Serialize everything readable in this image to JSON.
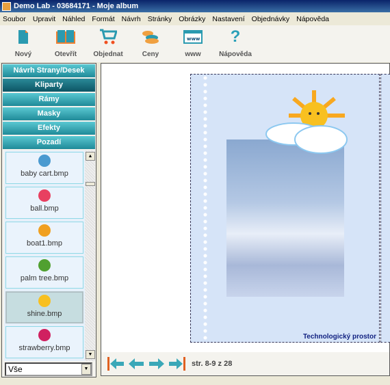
{
  "window": {
    "title": "Demo Lab - 03684171 - Moje album"
  },
  "menu": [
    "Soubor",
    "Upravit",
    "Náhled",
    "Formát",
    "Návrh",
    "Stránky",
    "Obrázky",
    "Nastavení",
    "Objednávky",
    "Nápověda"
  ],
  "toolbar": [
    {
      "label": "Nový",
      "icon": "new-document-icon"
    },
    {
      "label": "Otevřít",
      "icon": "open-book-icon"
    },
    {
      "label": "Objednat",
      "icon": "cart-icon"
    },
    {
      "label": "Ceny",
      "icon": "coins-icon"
    },
    {
      "label": "www",
      "icon": "www-icon"
    },
    {
      "label": "Nápověda",
      "icon": "help-icon"
    }
  ],
  "accordion": [
    "Návrh Strany/Desek",
    "Kliparty",
    "Rámy",
    "Masky",
    "Efekty",
    "Pozadí"
  ],
  "cliparts": [
    {
      "name": "baby cart.bmp",
      "color": "#4a9ad0"
    },
    {
      "name": "ball.bmp",
      "color": "#e84060"
    },
    {
      "name": "boat1.bmp",
      "color": "#f0a020"
    },
    {
      "name": "palm tree.bmp",
      "color": "#50a030"
    },
    {
      "name": "shine.bmp",
      "color": "#f8c020"
    },
    {
      "name": "strawberry.bmp",
      "color": "#d02060"
    }
  ],
  "selected_clipart": "shine.bmp",
  "filter": {
    "value": "Vše"
  },
  "page": {
    "footer_text": "Technologický prostor",
    "info": "str. 8-9 z 28"
  },
  "colors": {
    "accent": "#2aa0b0",
    "nav_arrow": "#3aa8b8",
    "nav_bar": "#e06020"
  }
}
